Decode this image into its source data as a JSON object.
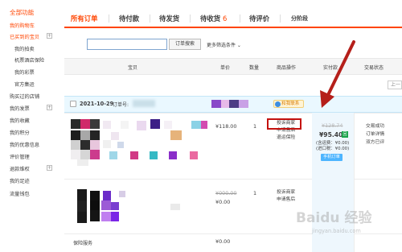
{
  "sidebar": {
    "title": "全部功能",
    "items": [
      {
        "label": "我的购物车",
        "red": true
      },
      {
        "label": "已买到的宝贝",
        "red": true,
        "plus": "+"
      },
      {
        "label": "我的拍卖"
      },
      {
        "label": "机票酒店保险"
      },
      {
        "label": "我的彩票"
      },
      {
        "label": "官方集运"
      },
      {
        "label": "购买过的店铺"
      },
      {
        "label": "我的发票",
        "plus": "+"
      },
      {
        "label": "我的收藏"
      },
      {
        "label": "我的积分"
      },
      {
        "label": "我的优惠信息"
      },
      {
        "label": "评价管理"
      },
      {
        "label": "退款维权",
        "plus": "+"
      },
      {
        "label": "我的足迹"
      },
      {
        "label": "流量钱包"
      }
    ]
  },
  "tabs": [
    {
      "label": "所有订单",
      "active": true
    },
    {
      "label": "待付款"
    },
    {
      "label": "待发货"
    },
    {
      "label": "待收货",
      "count": "6"
    },
    {
      "label": "待评价"
    },
    {
      "label": "分阶段"
    }
  ],
  "search": {
    "value": "",
    "button_label": "订单搜索",
    "more_filters": "更多筛选条件 ⌄"
  },
  "table_headers": {
    "product": "宝贝",
    "unit_price": "单价",
    "quantity": "数量",
    "item_ops": "商品操作",
    "paid": "实付款",
    "status": "交易状态"
  },
  "pager_label": "上一",
  "order": {
    "date": "2021-10-29",
    "order_no_label": "订单号:",
    "badge_label": "和我联系",
    "items": [
      {
        "price": "¥118.00",
        "qty": "1",
        "ops": [
          "投诉商家",
          "申请售后",
          "退运保险"
        ]
      },
      {
        "original_price": "¥000.00",
        "price": "¥0.00",
        "qty": "1",
        "ops": [
          "投诉商家",
          "申请售后"
        ]
      }
    ],
    "insurance_label": "保险服务",
    "insurance_price": "¥0.00",
    "paid": {
      "original": "¥128.74",
      "total": "¥95.40",
      "icon": "回",
      "note_lines": [
        "(含运费：¥0.00)",
        "(进口税：¥0.00)"
      ],
      "button_label": "手机订单"
    },
    "status_lines": [
      "交易成功",
      "订单详情",
      "双方已评"
    ]
  },
  "watermark": {
    "text": "Baidu 经验",
    "sub": "jingyan.baidu.com"
  },
  "colors": {
    "accent": "#ff4400",
    "highlight_box": "#c4120f",
    "arrow": "#b51f1a",
    "order_header_bg": "#eaf8ff"
  }
}
